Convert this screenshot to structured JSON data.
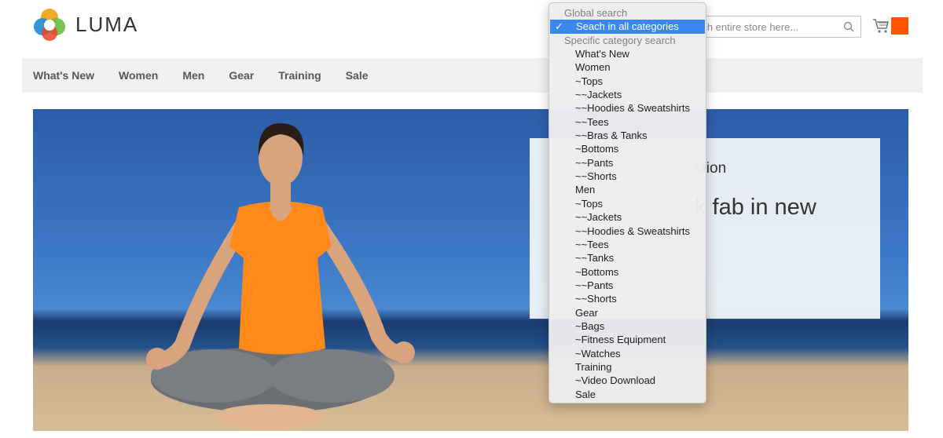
{
  "header": {
    "brand": "LUMA",
    "search_placeholder": "Search entire store here...",
    "search_visible_text": "rch entire store here..."
  },
  "nav": {
    "items": [
      "What's New",
      "Women",
      "Men",
      "Gear",
      "Training",
      "Sale"
    ]
  },
  "hero": {
    "promo_subtitle": "ction",
    "promo_title": "k fab in new"
  },
  "dropdown": {
    "groups": [
      {
        "label": "Global search",
        "options": [
          {
            "label": "Seach in all categories",
            "selected": true
          }
        ]
      },
      {
        "label": "Specific category search",
        "options": [
          {
            "label": "What's New"
          },
          {
            "label": "Women"
          },
          {
            "label": "~Tops"
          },
          {
            "label": "~~Jackets"
          },
          {
            "label": "~~Hoodies & Sweatshirts"
          },
          {
            "label": "~~Tees"
          },
          {
            "label": "~~Bras & Tanks"
          },
          {
            "label": "~Bottoms"
          },
          {
            "label": "~~Pants"
          },
          {
            "label": "~~Shorts"
          },
          {
            "label": "Men"
          },
          {
            "label": "~Tops"
          },
          {
            "label": "~~Jackets"
          },
          {
            "label": "~~Hoodies & Sweatshirts"
          },
          {
            "label": "~~Tees"
          },
          {
            "label": "~~Tanks"
          },
          {
            "label": "~Bottoms"
          },
          {
            "label": "~~Pants"
          },
          {
            "label": "~~Shorts"
          },
          {
            "label": "Gear"
          },
          {
            "label": "~Bags"
          },
          {
            "label": "~Fitness Equipment"
          },
          {
            "label": "~Watches"
          },
          {
            "label": "Training"
          },
          {
            "label": "~Video Download"
          },
          {
            "label": "Sale"
          }
        ]
      }
    ],
    "check_glyph": "✓"
  },
  "colors": {
    "accent": "#ff5501",
    "selection": "#3b87f0",
    "nav_bg": "#f0f0f0"
  }
}
